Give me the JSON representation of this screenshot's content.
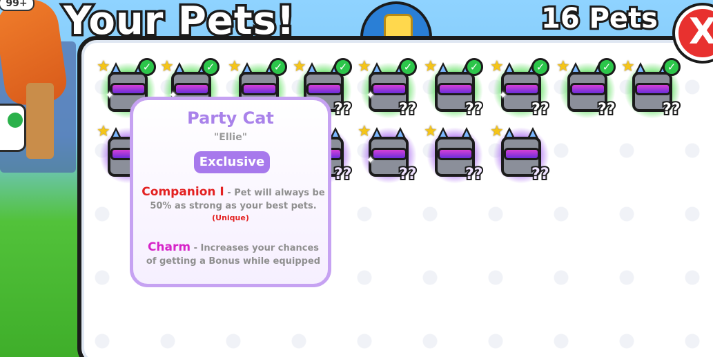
{
  "header": {
    "title": "Your Pets!",
    "pet_count": "16 Pets",
    "close_label": "X"
  },
  "background": {
    "counter": "99+"
  },
  "pets": {
    "equipped_count": 9,
    "unknown_label": "??"
  },
  "tooltip": {
    "name": "Party Cat",
    "nickname": "\"Ellie\"",
    "rarity": "Exclusive",
    "enchant1_name": "Companion I",
    "enchant1_desc": "- Pet will always be 50% as strong as your best pets.",
    "enchant1_note": "(Unique)",
    "enchant2_name": "Charm",
    "enchant2_desc": "- Increases your chances of getting a Bonus while equipped"
  },
  "colors": {
    "equipped_glow": "#50dc50",
    "unequipped_glow": "#aa6ef0",
    "tooltip_border": "#c6a2f2",
    "enchant1": "#e32121",
    "enchant2": "#d624c8"
  }
}
